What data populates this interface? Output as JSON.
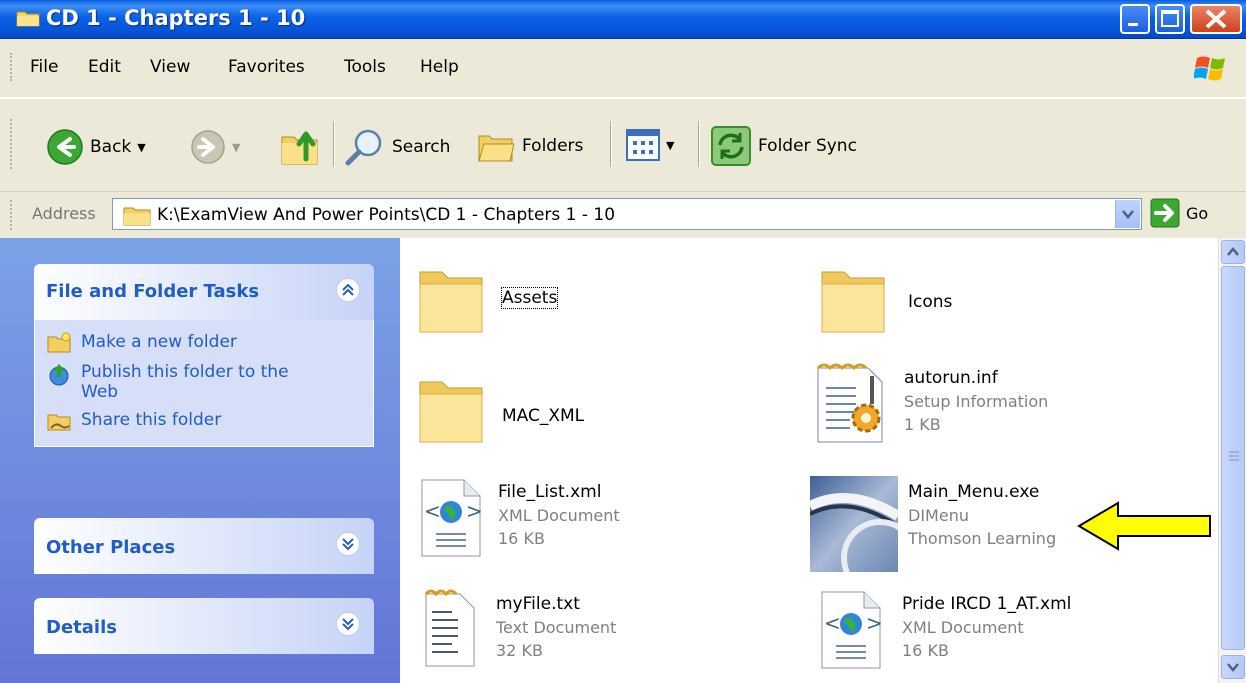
{
  "window": {
    "title": "CD 1 - Chapters 1 - 10",
    "controls": {
      "minimize": "_",
      "maximize": "□",
      "close": "✕"
    }
  },
  "menubar": {
    "items": [
      "File",
      "Edit",
      "View",
      "Favorites",
      "Tools",
      "Help"
    ]
  },
  "toolbar": {
    "back_label": "Back",
    "search_label": "Search",
    "folders_label": "Folders",
    "folder_sync_label": "Folder Sync"
  },
  "address": {
    "label": "Address",
    "value": "K:\\ExamView And Power Points\\CD 1 - Chapters 1 - 10",
    "go_label": "Go"
  },
  "taskpane": {
    "file_folder_tasks": {
      "title": "File and Folder Tasks",
      "items": [
        "Make a new folder",
        "Publish this folder to the Web",
        "Share this folder"
      ]
    },
    "other_places": {
      "title": "Other Places"
    },
    "details": {
      "title": "Details"
    }
  },
  "files": [
    {
      "name": "Assets",
      "type": "",
      "detail": ""
    },
    {
      "name": "Icons",
      "type": "",
      "detail": ""
    },
    {
      "name": "MAC_XML",
      "type": "",
      "detail": ""
    },
    {
      "name": "autorun.inf",
      "type": "Setup Information",
      "detail": "1 KB"
    },
    {
      "name": "File_List.xml",
      "type": "XML Document",
      "detail": "16 KB"
    },
    {
      "name": "Main_Menu.exe",
      "type": "DIMenu",
      "detail": "Thomson Learning"
    },
    {
      "name": "myFile.txt",
      "type": "Text Document",
      "detail": "32 KB"
    },
    {
      "name": "Pride IRCD 1_AT.xml",
      "type": "XML Document",
      "detail": "16 KB"
    }
  ],
  "colors": {
    "titlebar": "#0a5ee0",
    "taskpane_bg": "#6f8be0",
    "task_link": "#215dc6",
    "annotation_arrow": "#ffff00"
  }
}
